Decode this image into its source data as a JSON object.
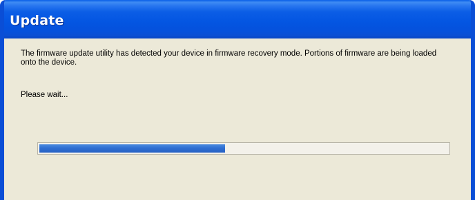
{
  "window": {
    "title": "Update"
  },
  "dialog": {
    "message": "The firmware update utility has detected your device in firmware recovery mode.  Portions of firmware are being loaded onto the device.",
    "status": "Please wait..."
  },
  "progress": {
    "fraction": 0.455
  },
  "colors": {
    "titlebar": "#0456e2",
    "window_bg": "#ece9d8",
    "progress_fill": "#2f6fd1"
  }
}
